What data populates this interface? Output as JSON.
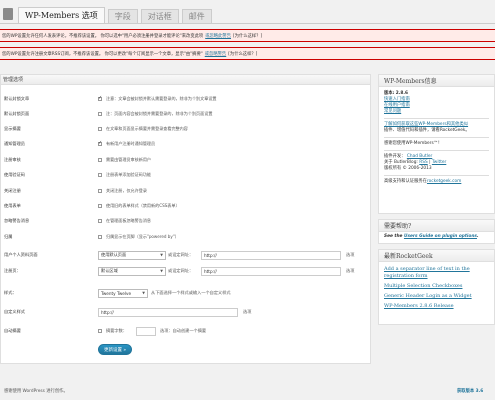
{
  "tabs": [
    "WP-Members 选项",
    "字段",
    "对话框",
    "邮件"
  ],
  "notices": [
    {
      "text": "您的WP设置允许任何人发表评论，不推荐该设置。  你可以选中\"用户必须注册并登录才能评论\"来改变此项",
      "link": "或忽略此警告",
      "tail": "[为什么这样？]"
    },
    {
      "text": "您的WP设置允许注册文章RSS订阅，不推荐该设置。  你可以更改\"每个订阅显示一个文章，显示\"由\"摘要\"",
      "link": "或忽略警告",
      "tail": "[为什么这样？]"
    }
  ],
  "panel": {
    "title": "管理选项",
    "rows": [
      {
        "label": "默认封锁文章",
        "checked": true,
        "desc": "注意：文章会被封锁并默认需要登录的，除非为个别文章设置"
      },
      {
        "label": "默认封锁页面",
        "checked": false,
        "desc": "注：页面内容会被封锁并需要登录的，除非为个别页面设置"
      },
      {
        "label": "显示摘要",
        "checked": false,
        "desc": "在文章和页面显示摘要并需登录查看完整内容"
      },
      {
        "label": "通知管理员",
        "checked": true,
        "desc": "有新用户注册时通知管理员"
      },
      {
        "label": "注册审核",
        "checked": false,
        "desc": "需要由管理员审核新用户"
      },
      {
        "label": "使用验证码",
        "checked": false,
        "desc": "注册表单添加验证码功能"
      },
      {
        "label": "关闭注册",
        "checked": false,
        "desc": "关闭注册，仅允许登录"
      },
      {
        "label": "使用表单",
        "checked": false,
        "desc": "使用旧的表单样式（禁用新的CSS表单）"
      },
      {
        "label": "忽略警告消息",
        "checked": false,
        "desc": "在管理面板忽略警告消息"
      },
      {
        "label": "归属",
        "checked": false,
        "desc": "归属显示在页脚（显示\"powered by\"）"
      }
    ],
    "profile_label": "用户个人资料页面",
    "profile_select": "使用默认页面",
    "profile_hint": "或设定网址：",
    "profile_url": "http://",
    "register_label": "注册页：",
    "register_select": "默认区域",
    "register_hint": "或设定网址：",
    "register_url": "http://",
    "go_label": "选项",
    "style_label": "样式：",
    "style_select": "Twenty Twelve",
    "style_note": "从下面选择一个样式或输入一个自定义样式",
    "css_label": "自定义样式",
    "css_value": "http://",
    "css_go": "选项",
    "autoexcerpt_label": "自动摘要",
    "autoexcerpt_checked": false,
    "autoexcerpt_text": "摘要字数：",
    "autoexcerpt_count": "",
    "autoexcerpt_note": "选项：自动创建一个摘要",
    "save_label": "更新设置 »"
  },
  "info_box": {
    "title": "WP-Members信息",
    "version": "版本: 2.8.6",
    "links": [
      "快速入门指南",
      "在线用户指南",
      "常见问题"
    ],
    "about": [
      "了解如何获取这些WP-Members和其他类似",
      "插件、增值代码和插件，请看RocketGeek。"
    ],
    "thanks": "感谢您使用WP-Members™!",
    "author_label": "插件开发：",
    "author": "Chad Butler",
    "follow_label": "关于 ButlerBlog:",
    "follow_links": [
      "RSS",
      "Twitter"
    ],
    "copyright": "版权所有 © 2006-2013",
    "support_label": "高级支持和认证服务在",
    "support_link": "rocketgeek.com"
  },
  "help_box": {
    "title": "需要帮助?",
    "text": "See the ",
    "link": "Users Guide on plugin options",
    "dot": "."
  },
  "rg_box": {
    "title": "最新RocketGeek",
    "links": [
      "Add a separator line of text in the registration form",
      "Multiple Selection Checkboxes",
      "Generic Header Login as a Widget",
      "WP-Members 2.8.6 Release"
    ]
  },
  "footer": {
    "left": "感谢使用 WordPress 进行创作。",
    "right": "获取版本 3.6"
  },
  "colors": {
    "accent": "#21759b",
    "notice_border": "#cc0000",
    "notice_bg": "#ffebe8"
  }
}
